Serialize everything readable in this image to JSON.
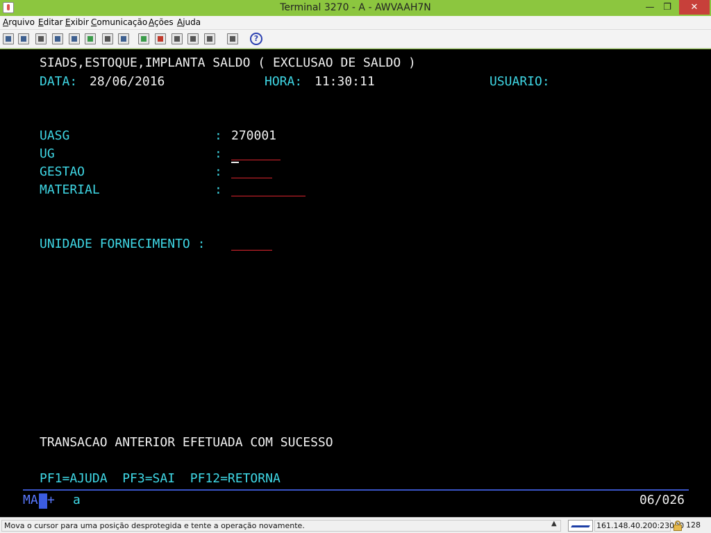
{
  "window": {
    "title": "Terminal 3270 - A - AWVAAH7N",
    "minimize_icon": "minimize-icon",
    "maximize_icon": "restore-icon",
    "close_icon": "close-icon"
  },
  "menu": [
    "Arquivo",
    "Editar",
    "Exibir",
    "Comunicação",
    "Ações",
    "Ajuda"
  ],
  "toolbar": {
    "icons": [
      "print-screen-icon",
      "print-icon",
      "edit-icon",
      "copy-icon",
      "paste-icon",
      "select-all-icon",
      "cut-icon",
      "keypad-icon",
      "play-macro-icon",
      "record-macro-icon",
      "stop-icon",
      "pause-icon",
      "send-icon",
      "receive-icon",
      "help-icon"
    ],
    "help_label": "?"
  },
  "terminal": {
    "header_title": "SIADS,ESTOQUE,IMPLANTA SALDO ( EXCLUSAO DE SALDO )",
    "data_label": "DATA:",
    "data_value": "28/06/2016",
    "hora_label": "HORA:",
    "hora_value": "11:30:11",
    "usuario_label": "USUARIO:",
    "fields": {
      "uasg_label": "UASG",
      "uasg_colon": ":",
      "uasg_value": "270001",
      "ug_label": "UG",
      "ug_colon": ":",
      "ug_value": "",
      "gestao_label": "GESTAO",
      "gestao_colon": ":",
      "gestao_value": "",
      "material_label": "MATERIAL",
      "material_colon": ":",
      "material_value": "",
      "unidade_label": "UNIDADE FORNECIMENTO :",
      "unidade_value": ""
    },
    "message": "TRANSACAO ANTERIOR EFETUADA COM SUCESSO",
    "pf_keys": "PF1=AJUDA  PF3=SAI  PF12=RETORNA",
    "oia_ma": "MA",
    "oia_plus": "+",
    "oia_a": "a",
    "cursor_position": "06/026"
  },
  "statusbar": {
    "message": "Mova o cursor para uma posição desprotegida e tente a operação novamente.",
    "host": "161.148.40.200:23000",
    "encryption_bits": "128",
    "lock_icon": "lock-icon"
  },
  "colors": {
    "title_bar": "#8cc63f",
    "terminal_bg": "#000000",
    "cyan_text": "#3fd8e6",
    "white_text": "#f2f2f2",
    "field_underline": "#e0252f",
    "oia_blue": "#3a55c8"
  }
}
